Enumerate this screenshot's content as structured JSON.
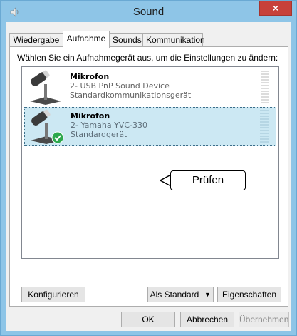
{
  "window": {
    "title": "Sound",
    "close_glyph": "×",
    "app_icon": "speaker-icon"
  },
  "tabs": [
    {
      "label": "Wiedergabe",
      "active": false
    },
    {
      "label": "Aufnahme",
      "active": true
    },
    {
      "label": "Sounds",
      "active": false
    },
    {
      "label": "Kommunikation",
      "active": false
    }
  ],
  "panel": {
    "instruction": "Wählen Sie ein Aufnahmegerät aus, um die Einstellungen zu ändern:"
  },
  "devices": [
    {
      "name": "Mikrofon",
      "description": "2- USB PnP Sound Device",
      "status": "Standardkommunikationsgerät",
      "selected": false,
      "icon": "microphone-icon"
    },
    {
      "name": "Mikrofon",
      "description": "2- Yamaha YVC-330",
      "status": "Standardgerät",
      "selected": true,
      "icon": "microphone-default-icon",
      "badge_icon": "green-checkmark-icon"
    }
  ],
  "callout": {
    "text": "Prüfen"
  },
  "panel_buttons": {
    "configure": "Konfigurieren",
    "set_default": "Als Standard",
    "set_default_arrow": "▼",
    "properties": "Eigenschaften"
  },
  "dialog_buttons": {
    "ok": "OK",
    "cancel": "Abbrechen",
    "apply": "Übernehmen"
  },
  "colors": {
    "titlebar": "#8ec5e7",
    "close_button": "#c7413a",
    "selection": "#cce8f3",
    "checkmark": "#2da84d"
  }
}
